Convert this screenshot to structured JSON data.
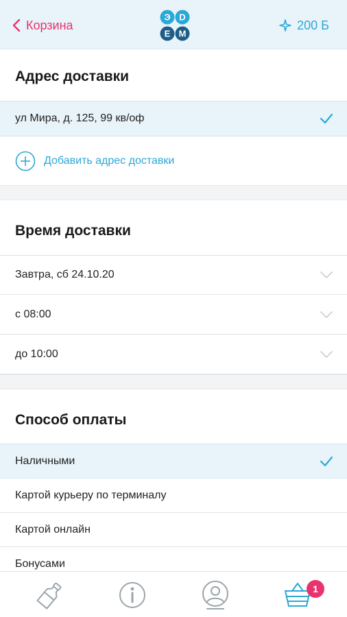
{
  "header": {
    "back_label": "Корзина",
    "bonus_label": "200 Б",
    "logo_letters": [
      "Э",
      "D",
      "E",
      "M"
    ]
  },
  "colors": {
    "accent_pink": "#e8336d",
    "accent_blue": "#2aa8d6",
    "header_bg": "#e8f4fa"
  },
  "address": {
    "title": "Адрес доставки",
    "selected_address": "ул Мира, д. 125, 99 кв/оф",
    "add_label": "Добавить адрес доставки"
  },
  "delivery_time": {
    "title": "Время доставки",
    "date": "Завтра, сб 24.10.20",
    "from": "с 08:00",
    "to": "до 10:00"
  },
  "payment": {
    "title": "Способ оплаты",
    "options": [
      "Наличными",
      "Картой курьеру по терминалу",
      "Картой онлайн",
      "Бонусами"
    ],
    "selected_index": 0
  },
  "tabbar": {
    "icons": [
      "bottle-icon",
      "info-icon",
      "profile-icon",
      "cart-icon"
    ],
    "cart_badge": "1"
  }
}
